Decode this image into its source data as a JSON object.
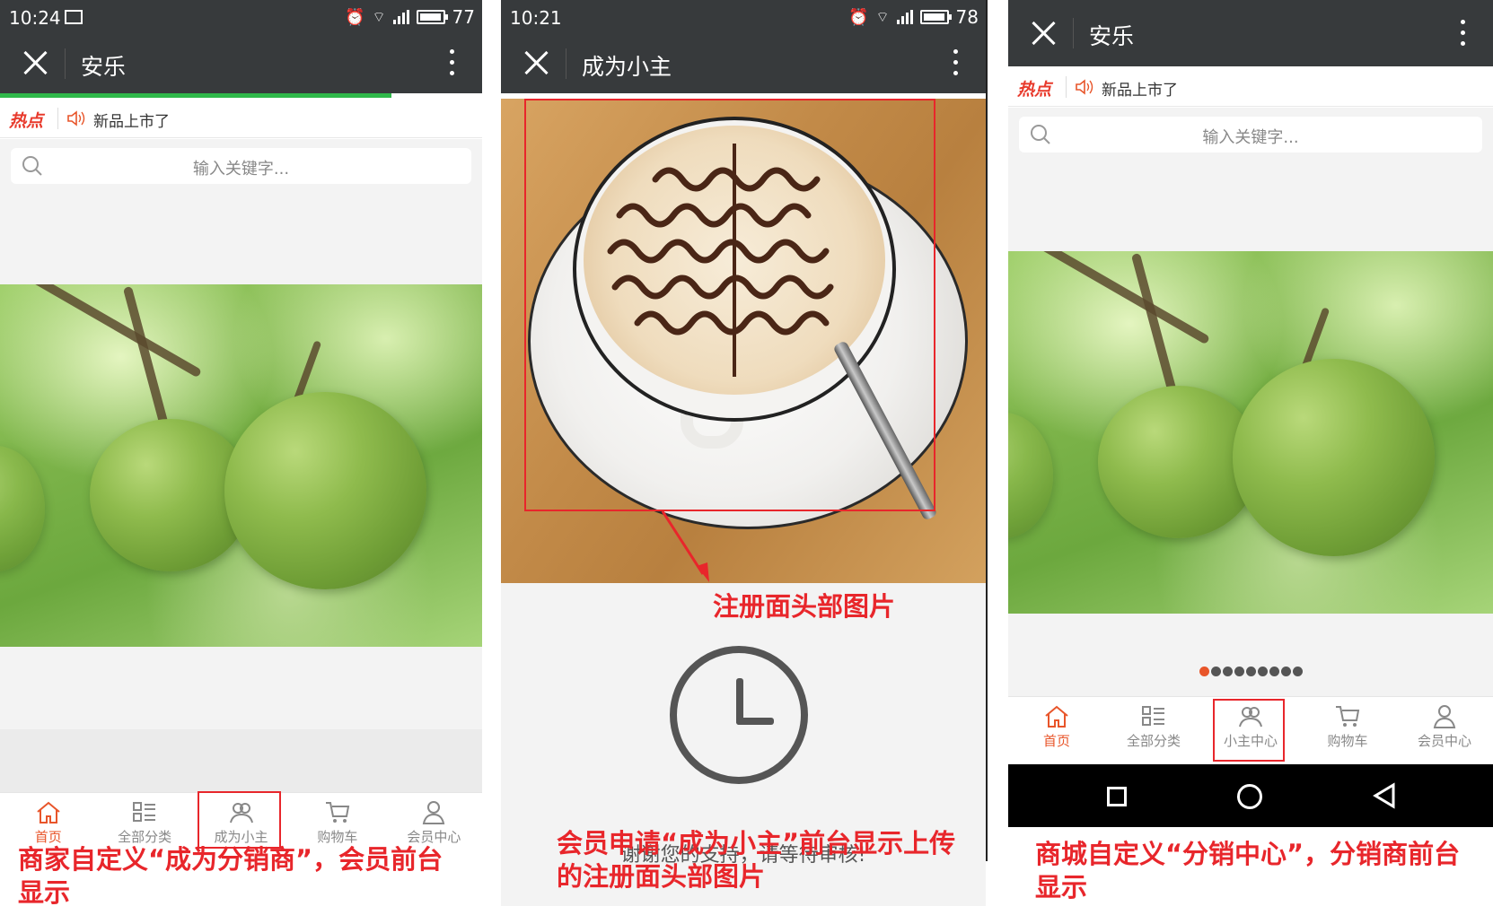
{
  "phone1": {
    "status": {
      "time": "10:24",
      "battery": "77"
    },
    "nav": {
      "title": "安乐"
    },
    "hot": {
      "tag": "热点",
      "news": "新品上市了"
    },
    "search": {
      "placeholder": "输入关键字..."
    },
    "tabs": [
      {
        "label": "首页",
        "icon": "home-icon"
      },
      {
        "label": "全部分类",
        "icon": "category-icon"
      },
      {
        "label": "成为小主",
        "icon": "people-icon"
      },
      {
        "label": "购物车",
        "icon": "cart-icon"
      },
      {
        "label": "会员中心",
        "icon": "user-icon"
      }
    ],
    "caption": "商家自定义“成为分销商”，会员前台显示"
  },
  "phone2": {
    "status": {
      "time": "10:21",
      "battery": "78"
    },
    "nav": {
      "title": "成为小主"
    },
    "annotation_arrow_label": "注册面头部图片",
    "message": "谢谢您的支持，请等待审核!",
    "caption": "会员申请“成为小主”前台显示上传的注册面头部图片"
  },
  "phone3": {
    "nav": {
      "title": "安乐"
    },
    "hot": {
      "tag": "热点",
      "news": "新品上市了"
    },
    "search": {
      "placeholder": "输入关键字..."
    },
    "carousel": {
      "total": 9,
      "active": 1
    },
    "tabs": [
      {
        "label": "首页",
        "icon": "home-icon"
      },
      {
        "label": "全部分类",
        "icon": "category-icon"
      },
      {
        "label": "小主中心",
        "icon": "people-icon"
      },
      {
        "label": "购物车",
        "icon": "cart-icon"
      },
      {
        "label": "会员中心",
        "icon": "user-icon"
      }
    ],
    "caption": "商城自定义“分销中心”，分销商前台显示"
  },
  "colors": {
    "accent": "#e8552a",
    "annotation": "#e8262b",
    "bar": "#373a3c"
  }
}
